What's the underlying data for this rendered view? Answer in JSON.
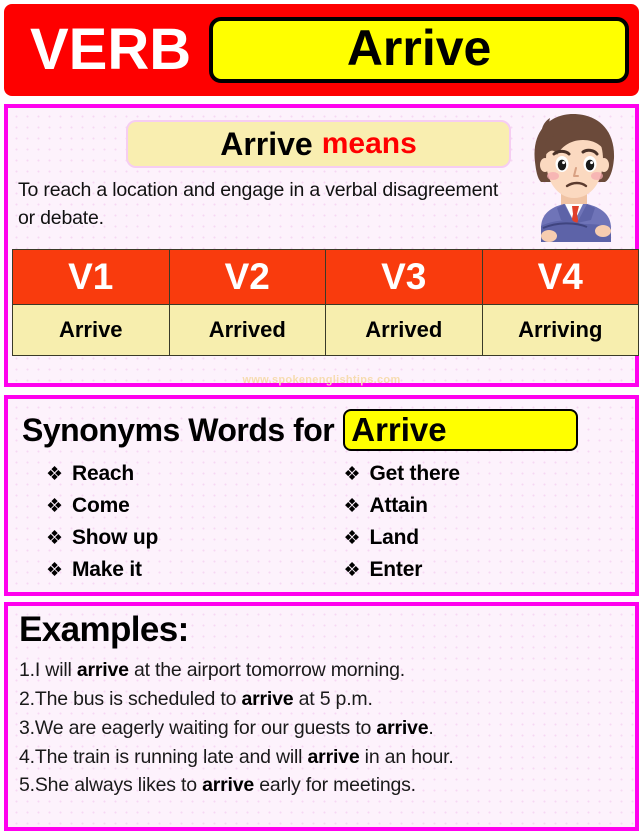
{
  "header": {
    "category_label": "VERB",
    "verb": "Arrive"
  },
  "definition": {
    "chip_word": "Arrive",
    "chip_suffix": "means",
    "text": "To reach a location and engage in a verbal disagreement or debate."
  },
  "verb_forms": {
    "headers": [
      "V1",
      "V2",
      "V3",
      "V4"
    ],
    "values": [
      "Arrive",
      "Arrived",
      "Arrived",
      "Arriving"
    ]
  },
  "watermark": "www.spokenenglishtips.com",
  "synonyms": {
    "title": "Synonyms Words for",
    "chip_word": "Arrive",
    "bullet_glyph": "❖",
    "left_column": [
      "Reach",
      "Come",
      "Show up",
      "Make it"
    ],
    "right_column": [
      "Get there",
      "Attain",
      "Land",
      "Enter"
    ]
  },
  "examples": {
    "title": "Examples:",
    "items": [
      {
        "number": "1.",
        "before": "I will ",
        "bold": "arrive",
        "after": " at the airport tomorrow morning."
      },
      {
        "number": "2.",
        "before": "The bus is scheduled to ",
        "bold": "arrive",
        "after": " at 5 p.m."
      },
      {
        "number": "3.",
        "before": "We are eagerly waiting for our guests to ",
        "bold": "arrive",
        "after": "."
      },
      {
        "number": "4.",
        "before": "The train is running late and will ",
        "bold": "arrive",
        "after": " in an hour."
      },
      {
        "number": "5.",
        "before": "She always likes to ",
        "bold": "arrive",
        "after": " early for meetings."
      }
    ]
  },
  "colors": {
    "header_red": "#FE0000",
    "chip_yellow": "#FFFF00",
    "panel_border_magenta": "#FF00EE",
    "table_header_orange": "#F93B0D",
    "table_cell_yellow": "#F7EEAE",
    "means_chip_yellow": "#F9EEB0",
    "accent_red_text": "#FF0000",
    "panel_background": "#FDF2FC"
  },
  "illustration": {
    "name": "confused-businessman",
    "hair": "#6b4a3a",
    "skin": "#fbd9c0",
    "suit": "#6f74b8",
    "tie": "#e0402b",
    "shirt": "#ffffff"
  }
}
